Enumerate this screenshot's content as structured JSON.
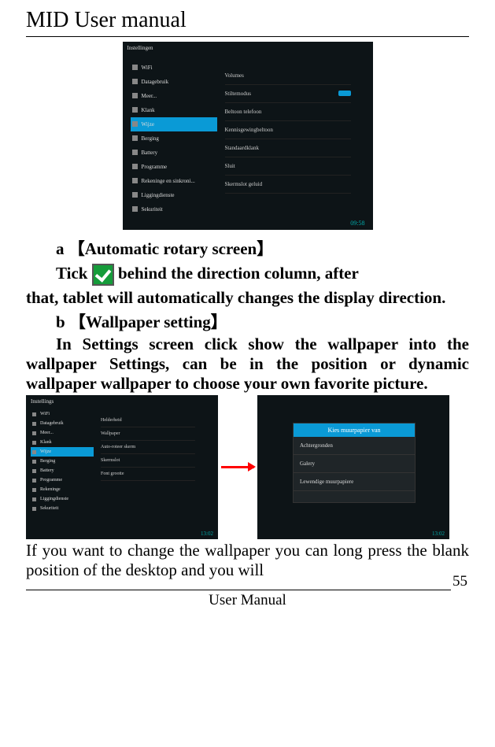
{
  "header": {
    "title": "MID User manual"
  },
  "screenshot1": {
    "group_label": "Instellingen",
    "sidebar": [
      "WiFi",
      "Datagebruik",
      "Meer...",
      "Klank",
      "Wijze",
      "Berging",
      "Battery",
      "Programme",
      "Rekeninge en sinkroni...",
      "Liggingdienste",
      "Sekuriteit"
    ],
    "selected_index": 4,
    "content": [
      "Volumes",
      "Stiltemodus",
      "Beltoon telefoon",
      "Kennisgewingbeltoon",
      "Standaardklank",
      "Sluit",
      "Skermslot geluid"
    ],
    "time": "09:58"
  },
  "sections": {
    "a_heading": "a  【Automatic rotary screen】",
    "tick_prefix": "Tick ",
    "tick_suffix": " behind the direction column, after",
    "a_body2": "that, tablet will automatically changes the display direction.",
    "b_heading": "b  【Wallpaper setting】",
    "b_body": "In Settings screen click show the wallpaper into the wallpaper Settings, can be in the position or dynamic wallpaper wallpaper to choose your own favorite picture."
  },
  "screenshot2": {
    "title": "Instellings",
    "sidebar": [
      "WiFi",
      "Datagebruik",
      "Meer...",
      "Klank",
      "Wijze",
      "Berging",
      "Battery",
      "Programme",
      "Rekeninge",
      "Liggingdienste",
      "Sekuriteit"
    ],
    "selected_index": 4,
    "content": [
      "Helderheid",
      "Wallpaper",
      "Auto-roteer skerm",
      "Skermslot",
      "Font grootte"
    ],
    "time": "13:02"
  },
  "screenshot3": {
    "dialog_title": "Kies muurpapier van",
    "options": [
      "Achtergronden",
      "Galery",
      "Lewendige muurpapiere"
    ],
    "time": "13:02"
  },
  "closing1": "If you want to change the wallpaper you can long press the blank position of the desktop and you will",
  "footer": {
    "page": "55",
    "label": "User Manual"
  }
}
